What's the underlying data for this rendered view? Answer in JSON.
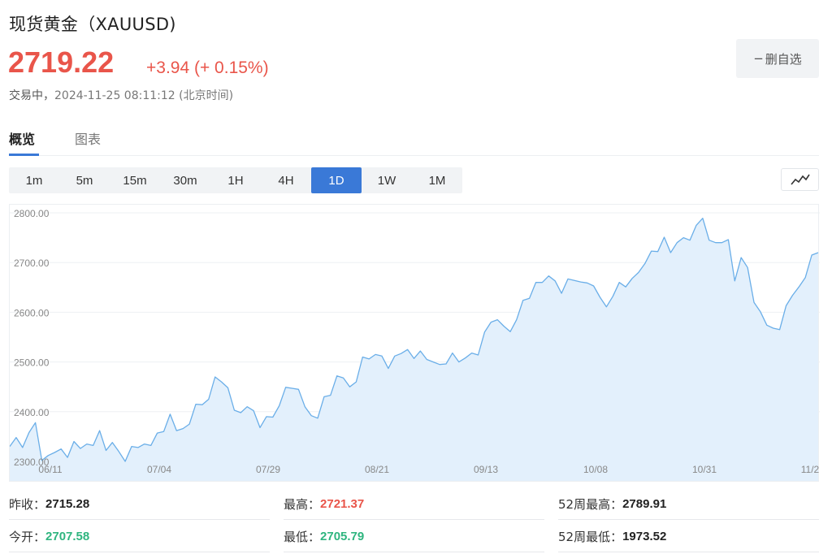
{
  "header": {
    "title": "现货黄金（XAUUSD)",
    "price": "2719.22",
    "change": "+3.94 (+ 0.15%)",
    "status": "交易中，",
    "timestamp": "2024-11-25 08:11:12 (北京时间)",
    "watch_button": "删自选",
    "watch_icon": "minus-icon"
  },
  "tabs": [
    {
      "label": "概览",
      "active": true
    },
    {
      "label": "图表",
      "active": false
    }
  ],
  "periods": [
    {
      "label": "1m",
      "active": false
    },
    {
      "label": "5m",
      "active": false
    },
    {
      "label": "15m",
      "active": false
    },
    {
      "label": "30m",
      "active": false
    },
    {
      "label": "1H",
      "active": false
    },
    {
      "label": "4H",
      "active": false
    },
    {
      "label": "1D",
      "active": true
    },
    {
      "label": "1W",
      "active": false
    },
    {
      "label": "1M",
      "active": false
    }
  ],
  "chart_type_icon": "line-chart-icon",
  "colors": {
    "up": "#e9554a",
    "down": "#2fb57f",
    "accent": "#3a79d7",
    "line": "#6aaee8",
    "area": "#e3f0fc"
  },
  "stats": [
    {
      "label": "昨收：",
      "value": "2715.28",
      "color": "dark"
    },
    {
      "label": "最高：",
      "value": "2721.37",
      "color": "red"
    },
    {
      "label": "52周最高：",
      "value": "2789.91",
      "color": "dark"
    },
    {
      "label": "今开：",
      "value": "2707.58",
      "color": "green"
    },
    {
      "label": "最低：",
      "value": "2705.79",
      "color": "green"
    },
    {
      "label": "52周最低：",
      "value": "1973.52",
      "color": "dark"
    }
  ],
  "chart_data": {
    "type": "area",
    "x_ticks": [
      "06/11",
      "07/04",
      "07/29",
      "08/21",
      "09/13",
      "10/08",
      "10/31",
      "11/2"
    ],
    "y_ticks": [
      "2800.00",
      "2700.00",
      "2600.00",
      "2500.00",
      "2400.00",
      "2300.00"
    ],
    "ylim": [
      2295,
      2805
    ],
    "grid": true,
    "values": [
      2330,
      2348,
      2328,
      2358,
      2378,
      2302,
      2312,
      2318,
      2325,
      2308,
      2340,
      2326,
      2335,
      2332,
      2362,
      2322,
      2338,
      2320,
      2300,
      2330,
      2328,
      2335,
      2332,
      2357,
      2360,
      2395,
      2362,
      2366,
      2375,
      2415,
      2414,
      2425,
      2470,
      2460,
      2448,
      2403,
      2398,
      2410,
      2402,
      2368,
      2390,
      2389,
      2412,
      2449,
      2447,
      2445,
      2410,
      2392,
      2387,
      2430,
      2433,
      2472,
      2468,
      2450,
      2460,
      2510,
      2506,
      2515,
      2512,
      2487,
      2512,
      2517,
      2525,
      2507,
      2522,
      2505,
      2500,
      2495,
      2496,
      2518,
      2500,
      2508,
      2518,
      2514,
      2560,
      2580,
      2585,
      2572,
      2561,
      2585,
      2624,
      2628,
      2660,
      2660,
      2673,
      2663,
      2638,
      2667,
      2664,
      2661,
      2659,
      2653,
      2630,
      2611,
      2632,
      2660,
      2651,
      2668,
      2680,
      2698,
      2723,
      2722,
      2751,
      2720,
      2740,
      2750,
      2745,
      2775,
      2789,
      2745,
      2740,
      2740,
      2746,
      2663,
      2710,
      2690,
      2620,
      2601,
      2574,
      2568,
      2565,
      2613,
      2634,
      2651,
      2670,
      2715,
      2720
    ]
  }
}
